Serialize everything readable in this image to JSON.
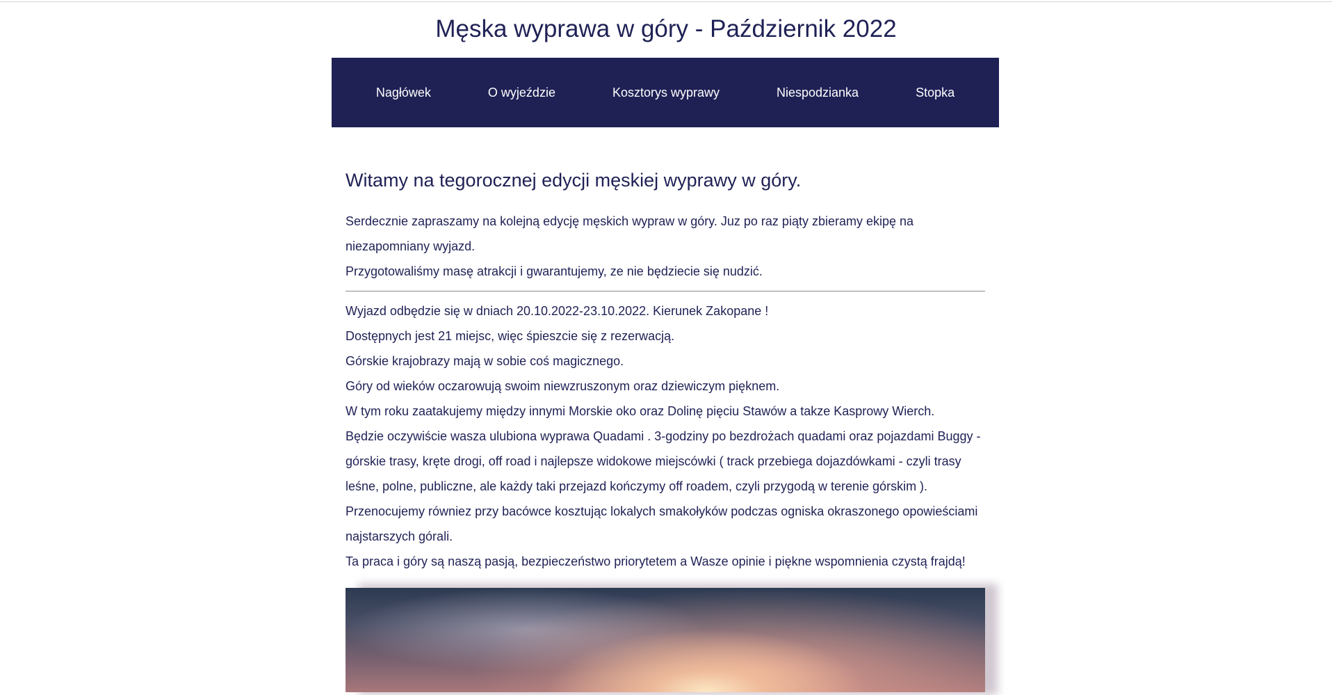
{
  "header": {
    "title": "Męska wyprawa w góry - Październik 2022"
  },
  "nav": {
    "items": [
      {
        "label": "Nagłówek"
      },
      {
        "label": "O wyjeździe"
      },
      {
        "label": "Kosztorys wyprawy"
      },
      {
        "label": "Niespodzianka"
      },
      {
        "label": "Stopka"
      }
    ]
  },
  "main": {
    "heading": "Witamy na tegorocznej edycji męskiej wyprawy w góry.",
    "intro": [
      "Serdecznie zapraszamy na kolejną edycję męskich wypraw w góry. Juz po raz piąty zbieramy ekipę na niezapomniany wyjazd.",
      "Przygotowaliśmy masę atrakcji i gwarantujemy, ze nie będziecie się nudzić."
    ],
    "details": [
      "Wyjazd odbędzie się w dniach 20.10.2022-23.10.2022. Kierunek Zakopane !",
      "Dostępnych jest 21 miejsc, więc śpieszcie się z rezerwacją.",
      "Górskie krajobrazy mają w sobie coś magicznego.",
      "Góry od wieków oczarowują swoim niewzruszonym oraz dziewiczym pięknem.",
      "W tym roku zaatakujemy między innymi Morskie oko oraz Dolinę pięciu Stawów a takze Kasprowy Wierch.",
      "Będzie oczywiście wasza ulubiona wyprawa Quadami . 3-godziny po bezdrożach quadami oraz pojazdami Buggy - górskie trasy, kręte drogi, off road i najlepsze widokowe miejscówki ( track przebiega dojazdówkami - czyli trasy leśne, polne, publiczne, ale każdy taki przejazd kończymy off roadem, czyli przygodą w terenie górskim ).",
      "Przenocujemy równiez przy bacówce kosztując lokalych smakołyków podczas ogniska okraszonego opowieściami najstarszych górali.",
      "Ta praca i góry są naszą pasją, bezpieczeństwo priorytetem a Wasze opinie i piękne wspomnienia czystą frajdą!"
    ]
  }
}
